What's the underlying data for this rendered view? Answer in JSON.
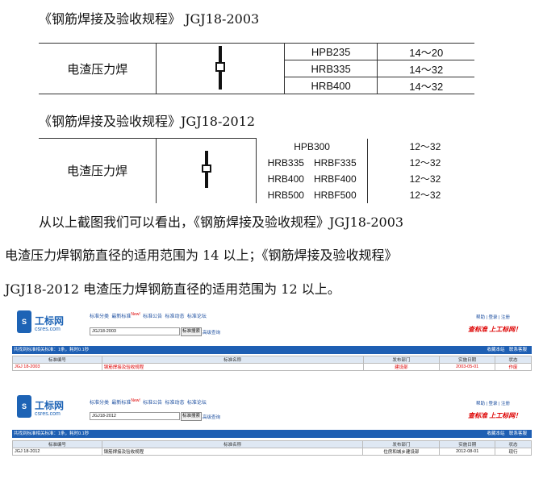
{
  "section_2003": {
    "heading": "《钢筋焊接及验收规程》 JGJ18-2003",
    "method": "电渣压力焊",
    "rows": [
      {
        "grade": "HPB235",
        "range": "14～20"
      },
      {
        "grade": "HRB335",
        "range": "14～32"
      },
      {
        "grade": "HRB400",
        "range": "14～32"
      }
    ]
  },
  "section_2012": {
    "heading": "《钢筋焊接及验收规程》JGJ18-2012",
    "method": "电渣压力焊",
    "rows": [
      {
        "grade": "HPB300",
        "range": "12～32"
      },
      {
        "grade": "HRB335　HRBF335",
        "range": "12～32"
      },
      {
        "grade": "HRB400　HRBF400",
        "range": "12～32"
      },
      {
        "grade": "HRB500　HRBF500",
        "range": "12～32"
      }
    ]
  },
  "paragraph": {
    "line1": "从以上截图我们可以看出，《钢筋焊接及验收规程》JGJ18-2003",
    "line2": "电渣压力焊钢筋直径的适用范围为 14 以上；《钢筋焊接及验收规程》",
    "line3": "JGJ18-2012 电渣压力焊钢筋直径的适用范围为 12 以上。"
  },
  "site": {
    "logo_name": "工标网",
    "logo_domain": "csres.com",
    "nav_items": [
      "标准分类",
      "最新标准",
      "标准公告",
      "标准动态",
      "标准论坛"
    ],
    "new_badge": "New!",
    "search_button": "标准搜索",
    "advanced": "高级查询",
    "top_links": "帮助 | 登录 | 注册",
    "slogan": "查标准 上工标网！",
    "bar_right": "收藏本站　联系客服",
    "col_headers": [
      "标准编号",
      "标准名称",
      "发布部门",
      "实施日期",
      "状态"
    ]
  },
  "shot1": {
    "query": "JGJ18-2003",
    "bar_left": "共找到标准相关标准：1条，耗时0.1秒",
    "row": [
      "JGJ 18-2003",
      "钢筋焊接及验收规程",
      "建设部",
      "2003-05-01",
      "作废"
    ]
  },
  "shot2": {
    "query": "JGJ18-2012",
    "bar_left": "共找到标准相关标准：1条，耗时0.1秒",
    "row": [
      "JGJ 18-2012",
      "钢筋焊接及验收规程",
      "住房和城乡建设部",
      "2012-08-01",
      "现行"
    ]
  }
}
